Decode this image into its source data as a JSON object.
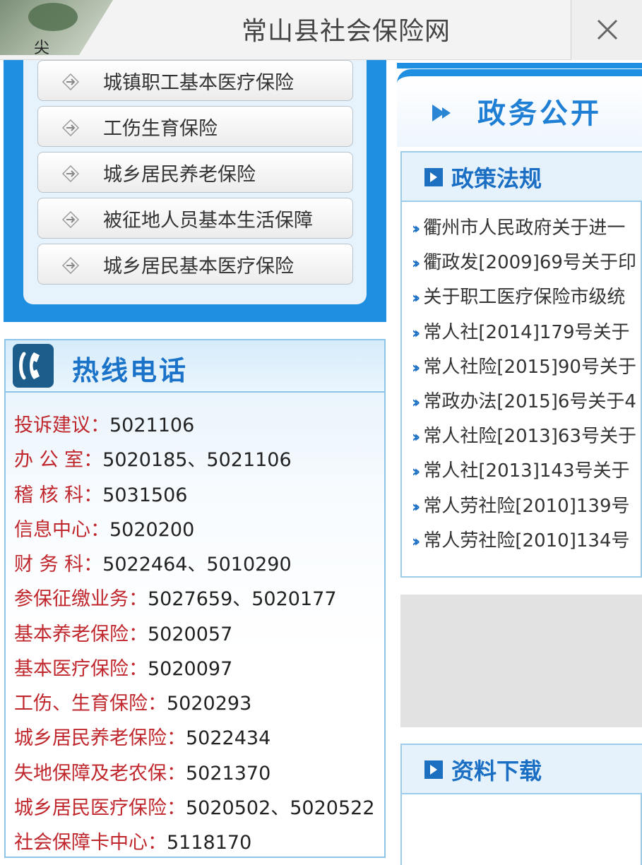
{
  "browser": {
    "page_title": "常山县社会保险网",
    "tab_thumb_char": "尖"
  },
  "menu": {
    "items": [
      {
        "label": "城镇职工基本医疗保险"
      },
      {
        "label": "工伤生育保险"
      },
      {
        "label": "城乡居民养老保险"
      },
      {
        "label": "被征地人员基本生活保障"
      },
      {
        "label": "城乡居民基本医疗保险"
      }
    ]
  },
  "hotline": {
    "title": "热线电话",
    "rows": [
      {
        "key": "投诉建议：",
        "value": "5021106"
      },
      {
        "key": "办 公 室：",
        "value": "5020185、5021106"
      },
      {
        "key": "稽 核 科：",
        "value": "5031506"
      },
      {
        "key": "信息中心：",
        "value": "5020200"
      },
      {
        "key": "财 务 科：",
        "value": "5022464、5010290"
      },
      {
        "key": "参保征缴业务：",
        "value": "5027659、5020177"
      },
      {
        "key": "基本养老保险：",
        "value": "5020057"
      },
      {
        "key": "基本医疗保险：",
        "value": "5020097"
      },
      {
        "key": "工伤、生育保险：",
        "value": "5020293"
      },
      {
        "key": "城乡居民养老保险：",
        "value": "5022434"
      },
      {
        "key": "失地保障及老农保：",
        "value": "5021370"
      },
      {
        "key": "城乡居民医疗保险：",
        "value": "5020502、5020522"
      },
      {
        "key": "社会保障卡中心：",
        "value": "5118170"
      }
    ]
  },
  "gov": {
    "banner_title": "政务公开"
  },
  "policy": {
    "title": "政策法规",
    "items": [
      "衢州市人民政府关于进一",
      "衢政发[2009]69号关于印",
      "关于职工医疗保险市级统",
      "常人社[2014]179号关于",
      "常人社险[2015]90号关于",
      "常政办法[2015]6号关于4",
      "常人社险[2013]63号关于",
      "常人社[2013]143号关于",
      "常人劳社险[2010]139号",
      "常人劳社险[2010]134号"
    ]
  },
  "downloads": {
    "title": "资料下载"
  }
}
